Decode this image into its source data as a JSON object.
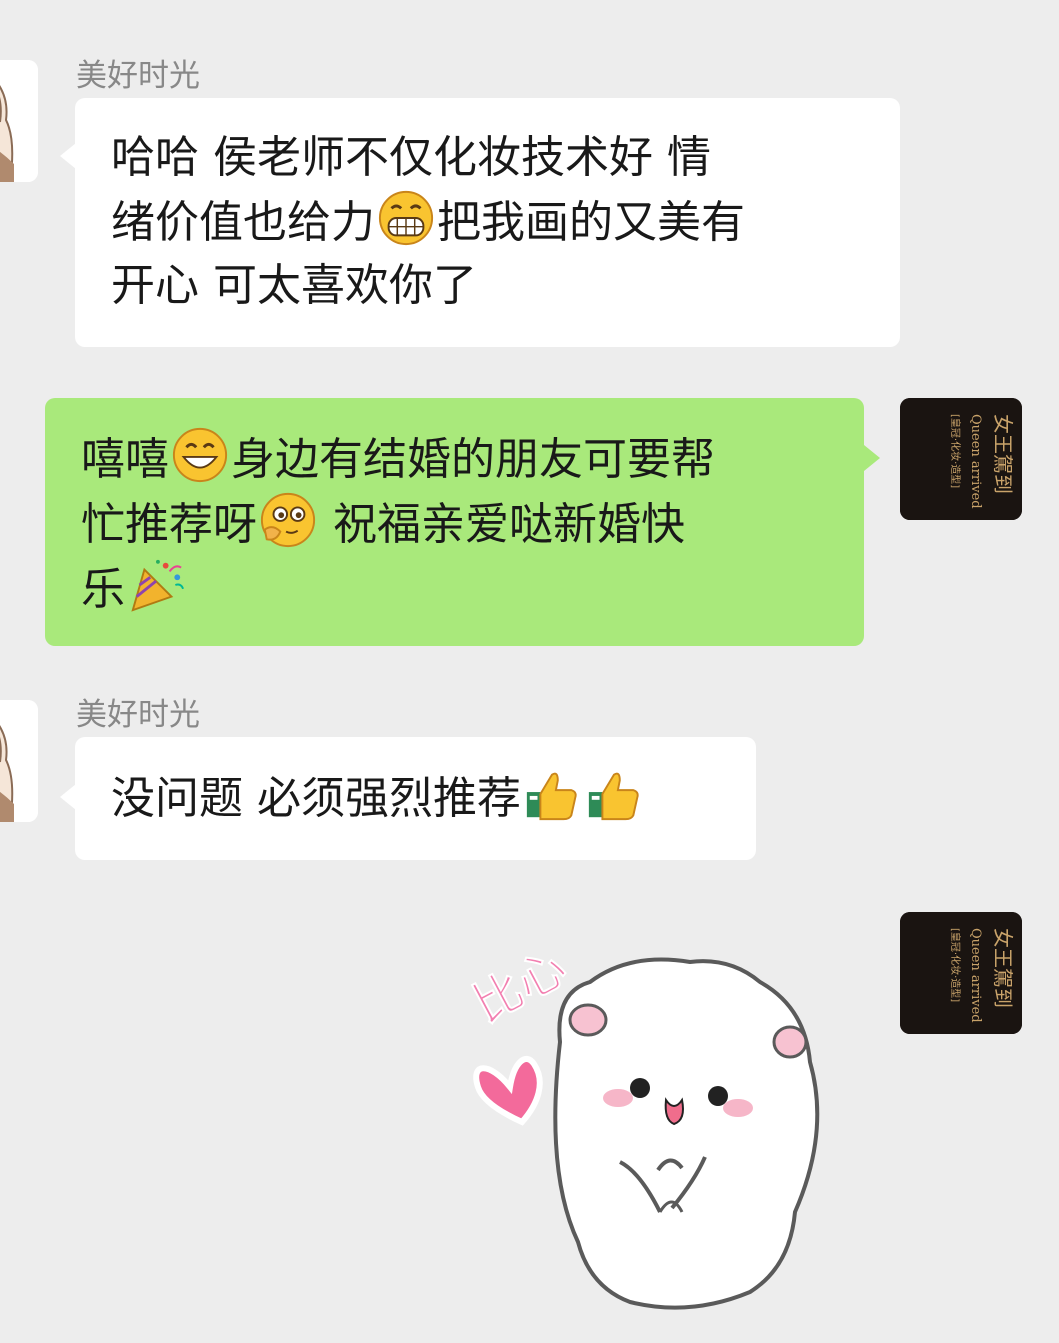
{
  "messages": [
    {
      "sender": "美好时光",
      "lines": [
        "哈哈 侯老师不仅化妆技术好 情",
        "绪价值也给力",
        "把我画的又美有",
        "开心 可太喜欢你了"
      ]
    },
    {
      "lines": [
        "嘻嘻",
        "身边有结婚的朋友可要帮",
        "忙推荐呀",
        " 祝福亲爱哒新婚快",
        "乐"
      ]
    },
    {
      "sender": "美好时光",
      "lines": [
        "没问题 必须强烈推荐"
      ]
    },
    {
      "sticker_text": "比心"
    }
  ],
  "contact_avatar": {
    "logo_text_cn": "女王駕到",
    "logo_text_en": "Queen arrived",
    "logo_sub": "[皇冠·化妆·造型]"
  },
  "colors": {
    "background": "#ededed",
    "incoming_bubble": "#ffffff",
    "outgoing_bubble": "#a9e97b",
    "name": "#888888"
  },
  "icons": {
    "emoji_1": "grinning-squinting-face-icon",
    "emoji_2": "grinning-face-icon",
    "emoji_3": "shy-thinking-face-icon",
    "emoji_4": "party-popper-icon",
    "emoji_5": "thumbs-up-icon"
  }
}
